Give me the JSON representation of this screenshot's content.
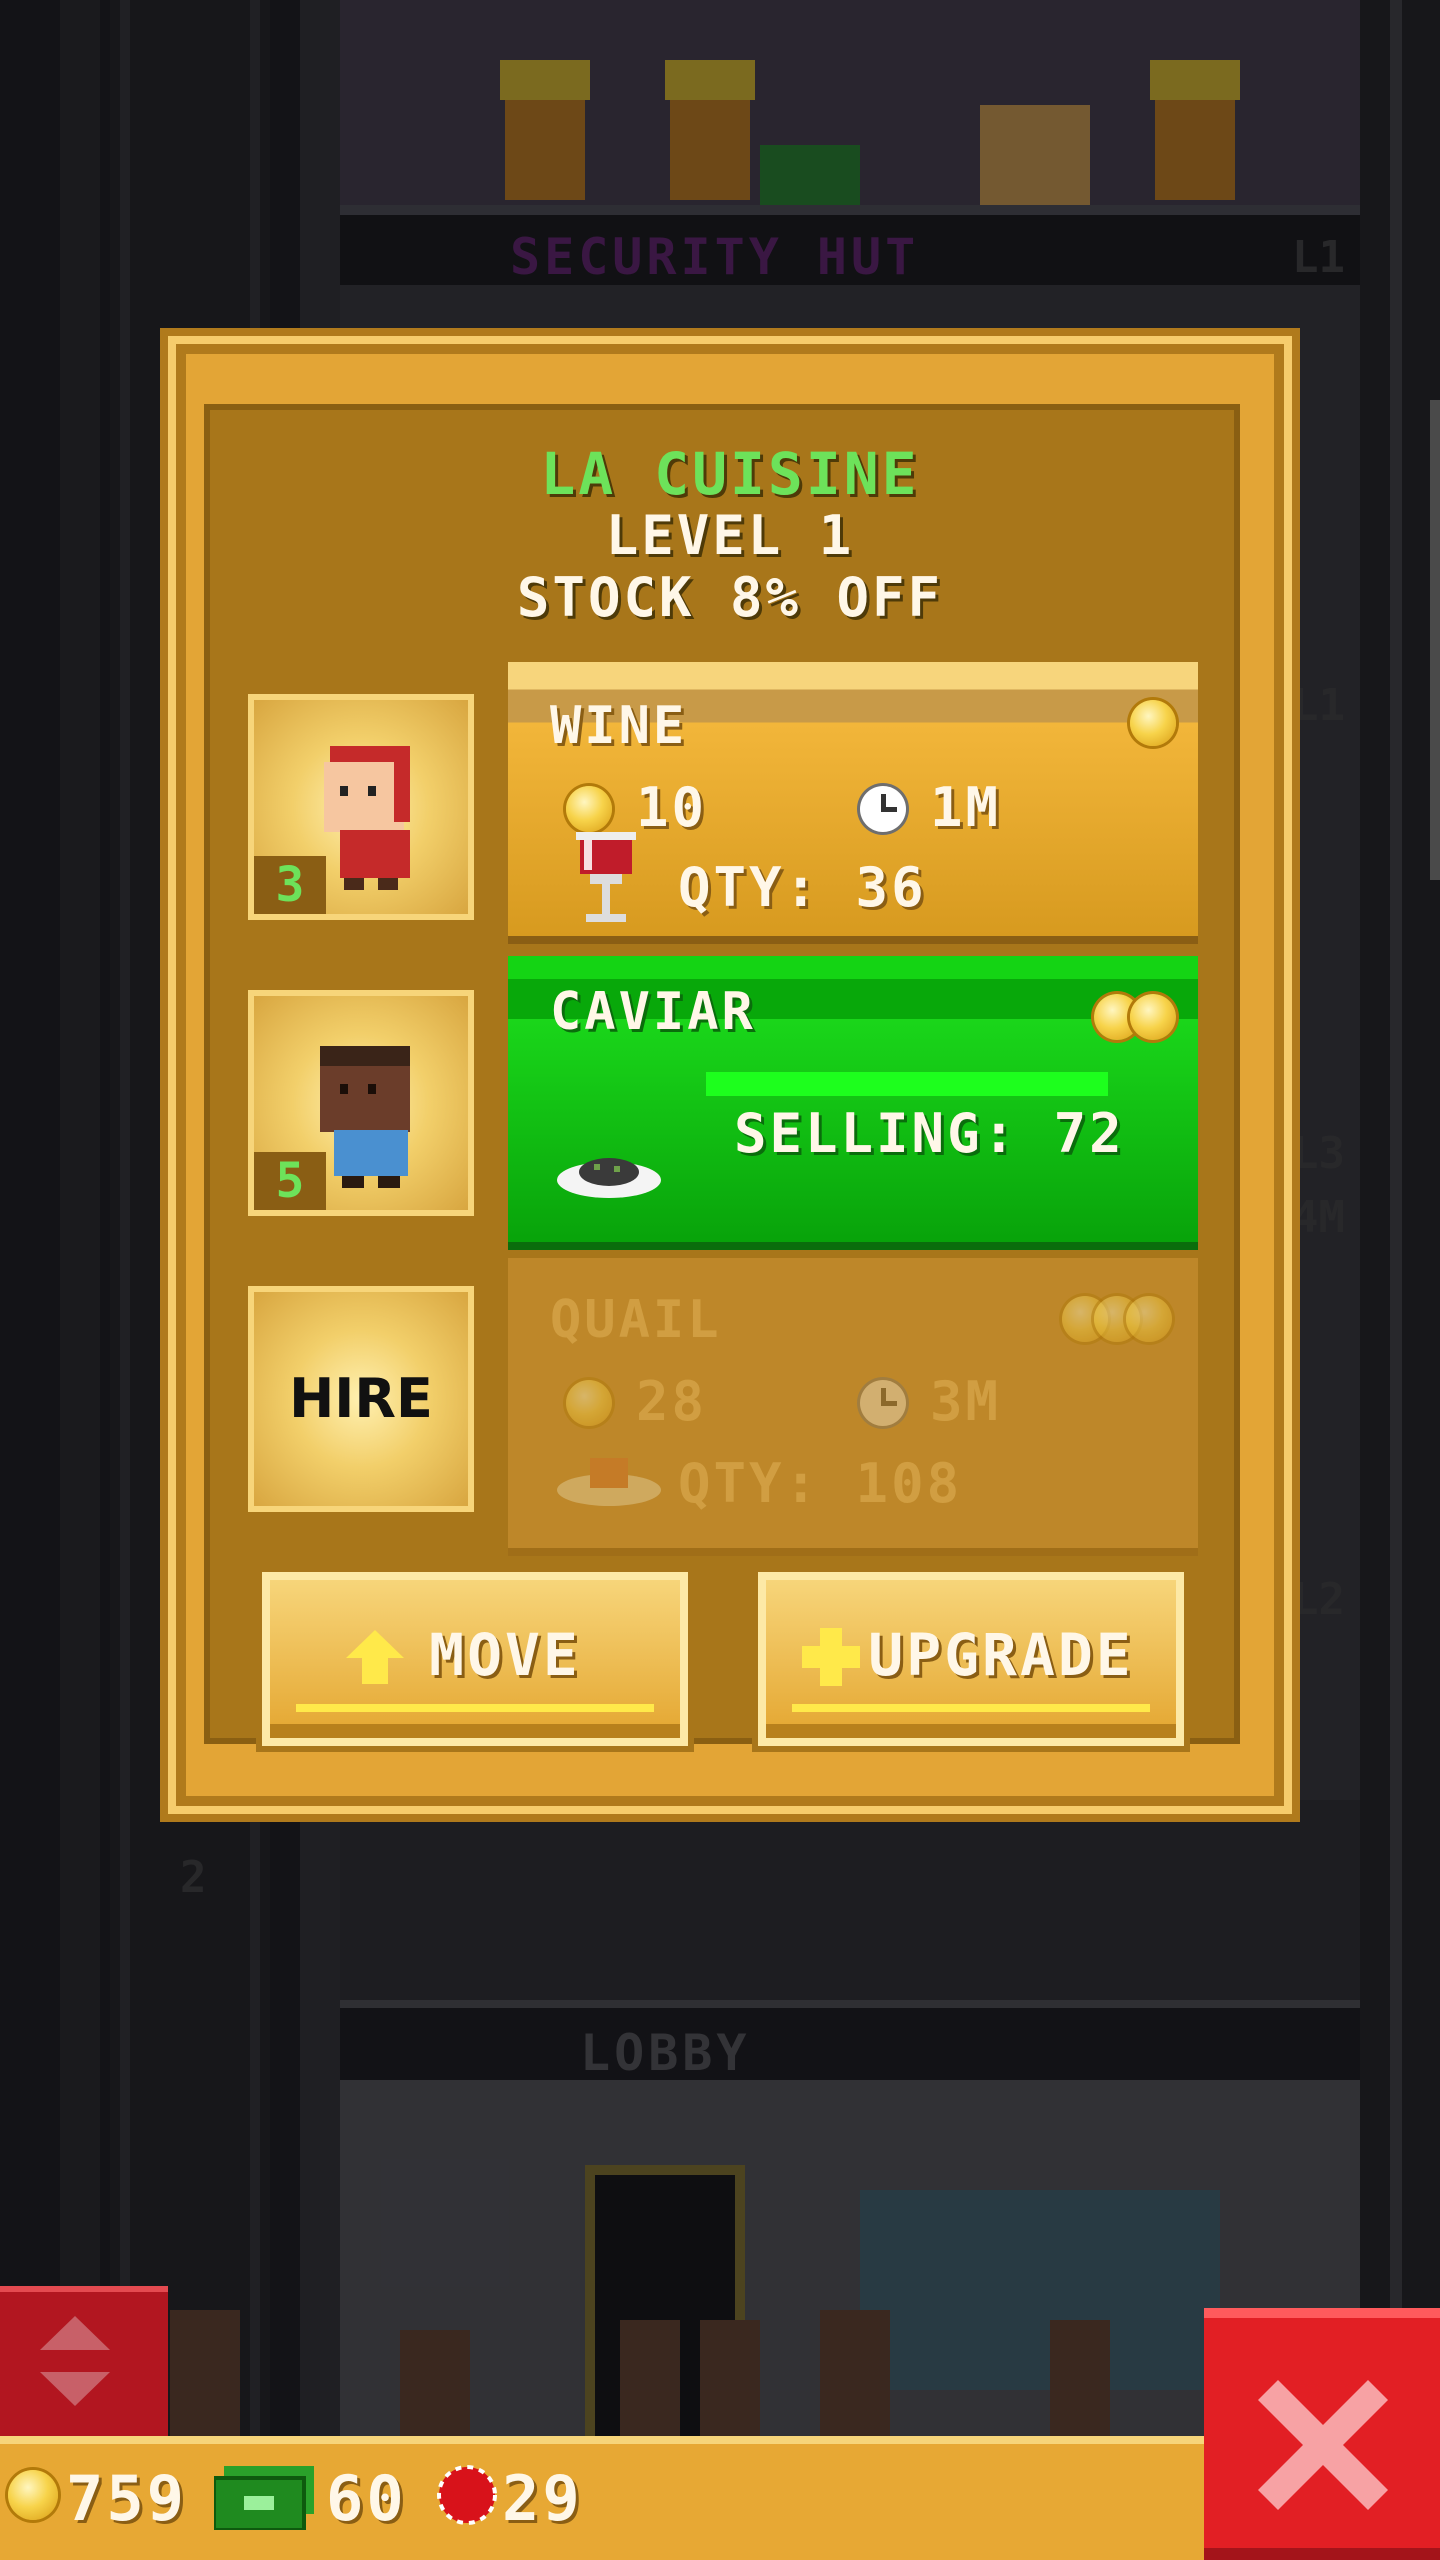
{
  "background": {
    "floors": [
      {
        "label": "SECURITY HUT",
        "level": "L1",
        "color": "#6a2a7a"
      },
      {
        "label": "LOBBY",
        "level": "",
        "color": "#7a7a7e"
      }
    ],
    "elevator_floor_number": "2",
    "side_levels": [
      "L1",
      "L3",
      "4M",
      "L2"
    ]
  },
  "dialog": {
    "shop_name": "LA CUISINE",
    "level": "LEVEL 1",
    "discount": "STOCK 8% OFF",
    "staff": [
      {
        "level": "3",
        "skin": "#f6c6a0",
        "shirt": "#c52a2a",
        "hair": "#c52a2a"
      },
      {
        "level": "5",
        "skin": "#6b3d2a",
        "shirt": "#4a90d0",
        "hair": "#3a2418"
      },
      {
        "hire_label": "HIRE"
      }
    ],
    "products": {
      "wine": {
        "name": "WINE",
        "cost": "10",
        "time": "1M",
        "qty": "QTY: 36",
        "tier_coins": 1
      },
      "caviar": {
        "name": "CAVIAR",
        "status": "SELLING: 72",
        "progress": 1.0,
        "tier_coins": 2
      },
      "quail": {
        "name": "QUAIL",
        "cost": "28",
        "time": "3M",
        "qty": "QTY: 108",
        "tier_coins": 3,
        "locked": true
      }
    },
    "buttons": {
      "move": "MOVE",
      "upgrade": "UPGRADE"
    }
  },
  "hud": {
    "coins": "759",
    "bux": "60",
    "tokens": "29"
  },
  "colors": {
    "accent_green": "#6de25a",
    "gold": "#e3a536",
    "close_red": "#e21f24"
  }
}
